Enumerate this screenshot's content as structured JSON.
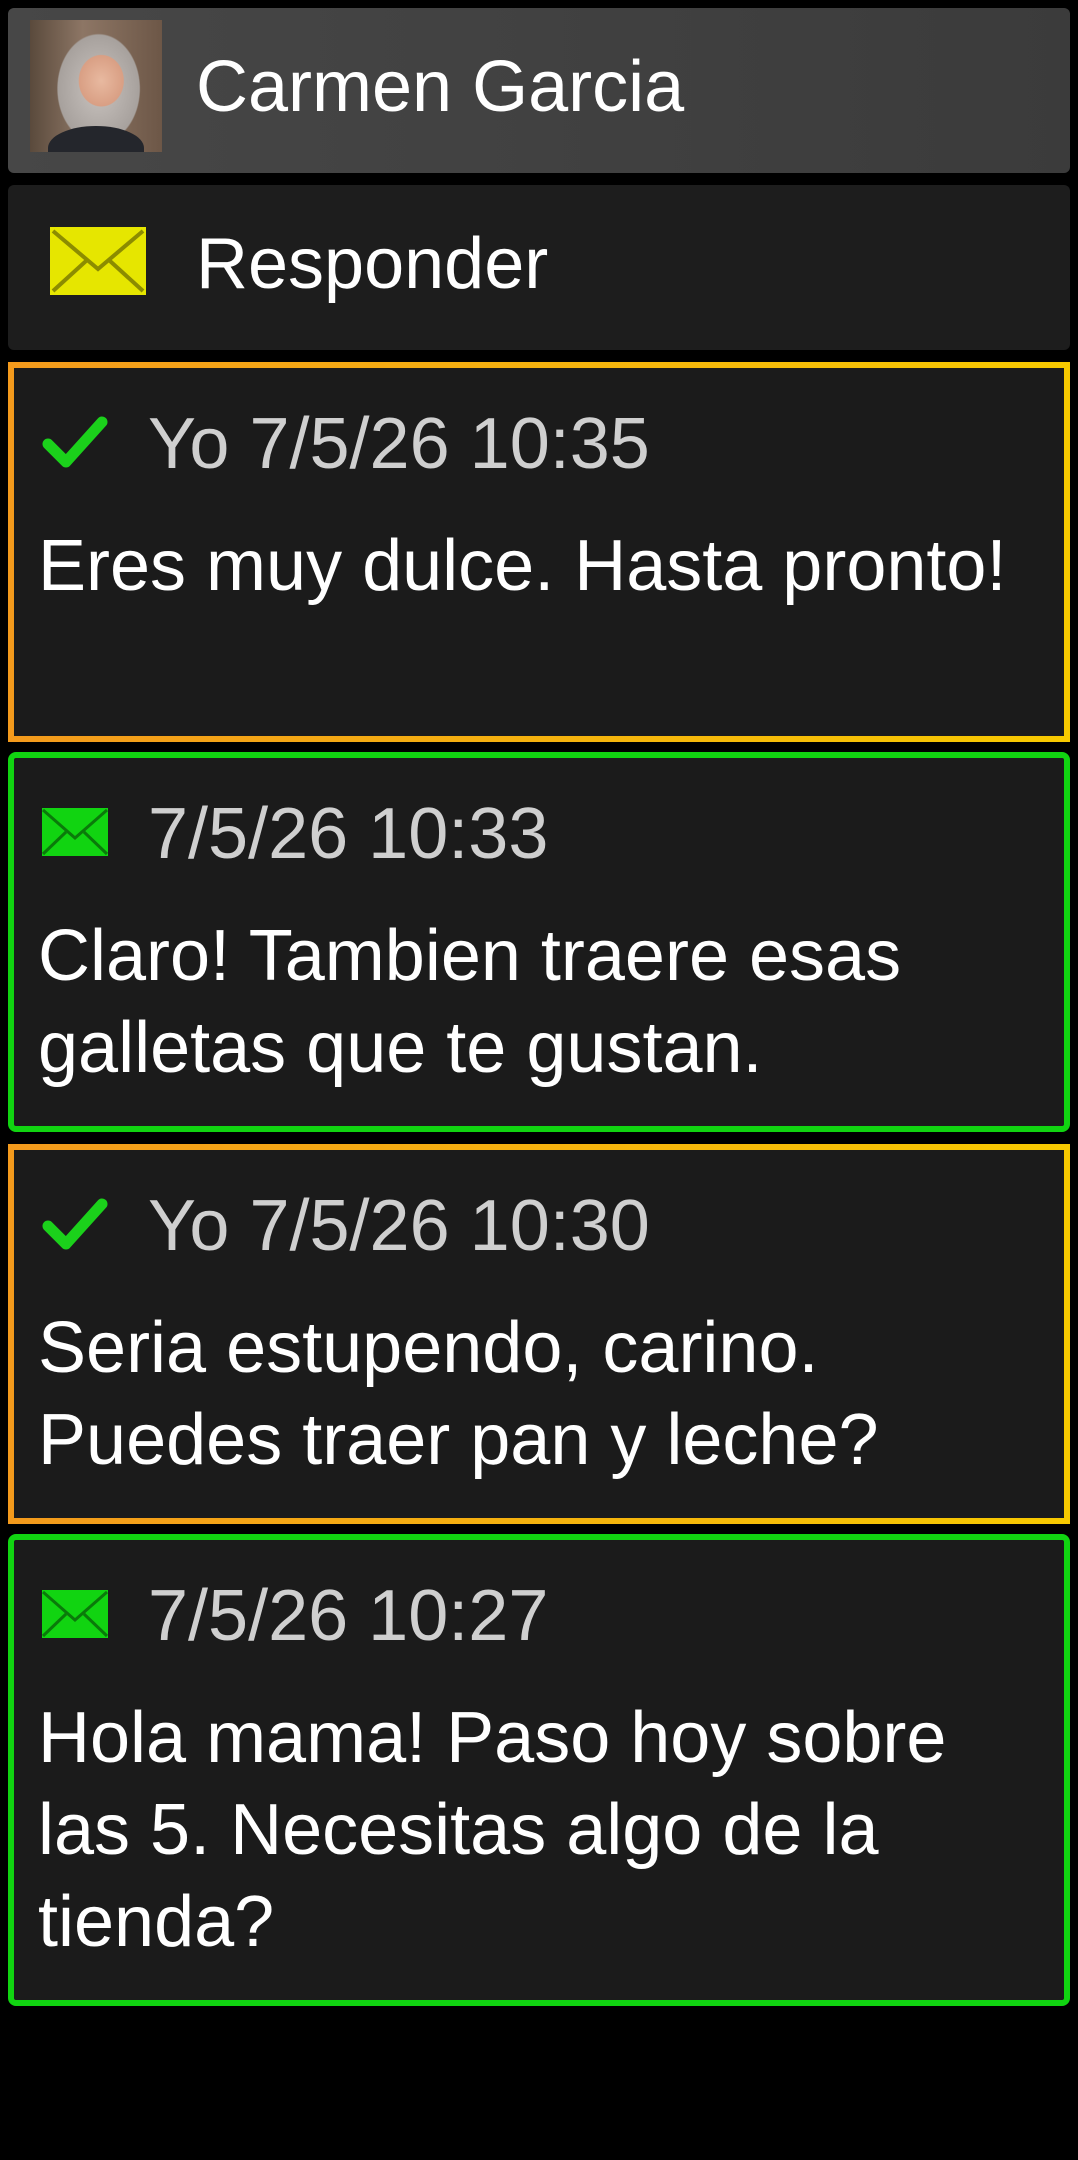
{
  "contact": {
    "name": "Carmen Garcia",
    "avatar_icon": "contact-photo"
  },
  "reply": {
    "label": "Responder",
    "icon": "envelope-icon",
    "icon_color": "#e6e600"
  },
  "colors": {
    "sent_border": "#f5b400",
    "received_border": "#11d411",
    "sent_check": "#1bd11b",
    "received_envelope": "#11d411",
    "background": "#000000",
    "card_background": "#1b1b1b"
  },
  "messages": [
    {
      "direction": "sent",
      "status_icon": "check-icon",
      "meta": "Yo 7/5/26 10:35",
      "text": "Eres muy dulce. Hasta pronto!"
    },
    {
      "direction": "received",
      "status_icon": "envelope-icon",
      "meta": "7/5/26 10:33",
      "text": "Claro! Tambien traere esas galletas que te gustan."
    },
    {
      "direction": "sent",
      "status_icon": "check-icon",
      "meta": "Yo 7/5/26 10:30",
      "text": "Seria estupendo, carino. Puedes traer pan y leche?"
    },
    {
      "direction": "received",
      "status_icon": "envelope-icon",
      "meta": "7/5/26 10:27",
      "text": "Hola mama! Paso hoy sobre las 5. Necesitas algo de la tienda?"
    }
  ]
}
